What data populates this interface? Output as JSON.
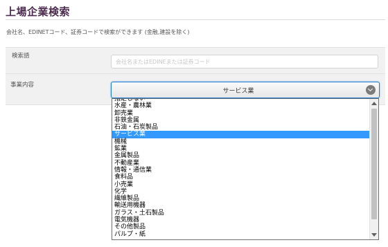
{
  "page": {
    "title": "上場企業検索",
    "description": "会社名、EDINETコード、証券コードで検索ができます (金融,建設を除く)"
  },
  "form": {
    "keyword_label": "検索語",
    "keyword_placeholder": "会社名またはEDINEまたは証券コード",
    "business_label": "事業内容",
    "business_selected": "サービス業",
    "business_options": [
      "指定しない",
      "水産・農林業",
      "卸売業",
      "非鉄金属",
      "石油・石炭製品",
      "サービス業",
      "機械",
      "鉱業",
      "金属製品",
      "不動産業",
      "情報・通信業",
      "食料品",
      "小売業",
      "化学",
      "繊維製品",
      "輸送用機器",
      "ガラス・土石製品",
      "電気機器",
      "その他製品",
      "パルプ・紙"
    ],
    "selected_index": 5
  },
  "icons": {
    "select_arrow": "chevron-down-circle-icon"
  },
  "colors": {
    "title": "#4b2c4f",
    "highlight": "#3399ff",
    "focus_border": "#1e7bd1"
  }
}
